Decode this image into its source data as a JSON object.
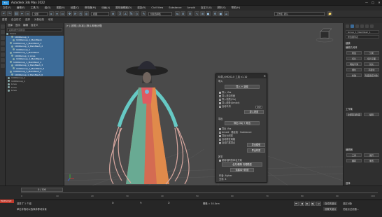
{
  "window": {
    "title": "Autodesk 3ds Max 2022",
    "app_icon": "3ds-max-icon",
    "min": "—",
    "max": "□",
    "close": "✕"
  },
  "menu": [
    "文件(F)",
    "编辑(E)",
    "工具(T)",
    "组(G)",
    "视图(V)",
    "创建(C)",
    "修改器(M)",
    "动画(A)",
    "图形编辑器(D)",
    "渲染(R)",
    "Civil View",
    "Substance",
    "Arnold",
    "自定义(U)",
    "脚本(S)",
    "帮助(H)"
  ],
  "toolbar": {
    "selection_filter": "全部",
    "view_select": "视图",
    "create_selection_set": "创建选择集",
    "workspace": "工作区: 默认"
  },
  "ribbon_tabs": [
    "建模",
    "自由形式",
    "选择",
    "对象绘制",
    "填充"
  ],
  "scene_explorer": {
    "tabs": [
      "选择",
      "显示",
      "编辑",
      "自定义"
    ],
    "search": "名称(按升序排序)",
    "rows": [
      {
        "label": "Scene",
        "sel": false
      },
      {
        "label": "1000Group_1",
        "sel": true
      },
      {
        "label": "1000Group_1_MainMesh",
        "sel": true
      },
      {
        "label": "1000Group_1_MainMesh_1",
        "sel": true
      },
      {
        "label": "1000Group_1_MainMesh_2",
        "sel": true
      },
      {
        "label": "1000Group_1",
        "sel": true
      },
      {
        "label": "1000Group_1_MainMesh",
        "sel": true
      },
      {
        "label": "1000Group_1_Lines",
        "sel": true
      },
      {
        "label": "1000Group_1_MainMesh_1",
        "sel": true
      },
      {
        "label": "1000Group_1_MainMesh_2",
        "sel": true
      },
      {
        "label": "1000Group_1_MainMesh_3",
        "sel": true
      },
      {
        "label": "1000Group_1_MainMesh_4",
        "sel": true
      },
      {
        "label": "1000Group_1_MainMesh_5",
        "sel": true
      },
      {
        "label": "1000Group_1_MainMesh_6",
        "sel": true
      },
      {
        "label": "1000Group_1",
        "sel": false
      },
      {
        "label": "1000Group_1",
        "sel": false
      },
      {
        "label": "Lines",
        "sel": false
      },
      {
        "label": "Lines",
        "sel": false
      },
      {
        "label": "Lines",
        "sel": false
      }
    ]
  },
  "viewport": {
    "label": "[+] [透视] [标准] [默认明暗处理]"
  },
  "dialog": {
    "title": "3D导入MD/CLO 工具 v1.10",
    "close": "✕",
    "sec_import": "导入",
    "btn_import": "导入 + 选择",
    "checks": [
      {
        "label": "导入 .fbx",
        "on": true
      },
      {
        "label": "导入多边形面",
        "on": false
      },
      {
        "label": "导入材质(Clo)",
        "on": false
      },
      {
        "label": "导入线条(Arnold)",
        "on": true
      },
      {
        "label": "自动平滑",
        "on": false
      }
    ],
    "spinner_value": "0.0",
    "btn_reimport": "导入材质",
    "sec_export": "导出",
    "btn_export": "导出 Obj + 导出",
    "checks2": [
      {
        "label": "导出 .fbx",
        "on": true
      },
      {
        "label": "Arnold · 路径线 · Substance",
        "on": false
      },
      {
        "label": "导出为材质",
        "on": true
      },
      {
        "label": "自动修复网格",
        "on": false
      },
      {
        "label": "自动扩展顶点",
        "on": false
      }
    ],
    "btn_a": "导出模型",
    "btn_b": "导出材质",
    "sec_other": "其它",
    "checks3": [
      {
        "label": "使用相同的命名方案",
        "on": true
      }
    ],
    "btn_c": "合并/删除 清理模型",
    "btn_d": "清除ID+材质",
    "footer1": "作者: Alyher",
    "footer2": "交流: 4"
  },
  "command_panel": {
    "sections": [
      "建模",
      "编辑几何体",
      "工作集",
      "编辑器",
      "材质",
      "选择"
    ],
    "fields": [
      "Group_1_MainMesh_1",
      "修改器列表"
    ],
    "buttons": [
      "附加",
      "分离",
      "切片",
      "切片平面",
      "网格平滑",
      "优化",
      "细化",
      "平面化",
      "松弛",
      "隐藏选定对象",
      "全部取消隐藏",
      "编辑",
      "工具",
      "展开",
      "翻转",
      "重置"
    ]
  },
  "timeline": {
    "ticks": [
      "0",
      "10",
      "20",
      "30",
      "40",
      "50",
      "60",
      "70",
      "80",
      "90",
      "100"
    ],
    "frame": "0 / 100"
  },
  "status": {
    "maxscript": "MAXScript",
    "selected": "选择了 1 个组",
    "hint": "单击并拖动以选择并移动对象",
    "x_label": "X:",
    "y_label": "Y:",
    "z_label": "Z:",
    "grid": "栅格 = 10.0cm",
    "auto_key": "自动关键点",
    "set_key": "设置关键点",
    "selected_obj": "选定对象",
    "key_filter": "关键点过滤器..."
  }
}
